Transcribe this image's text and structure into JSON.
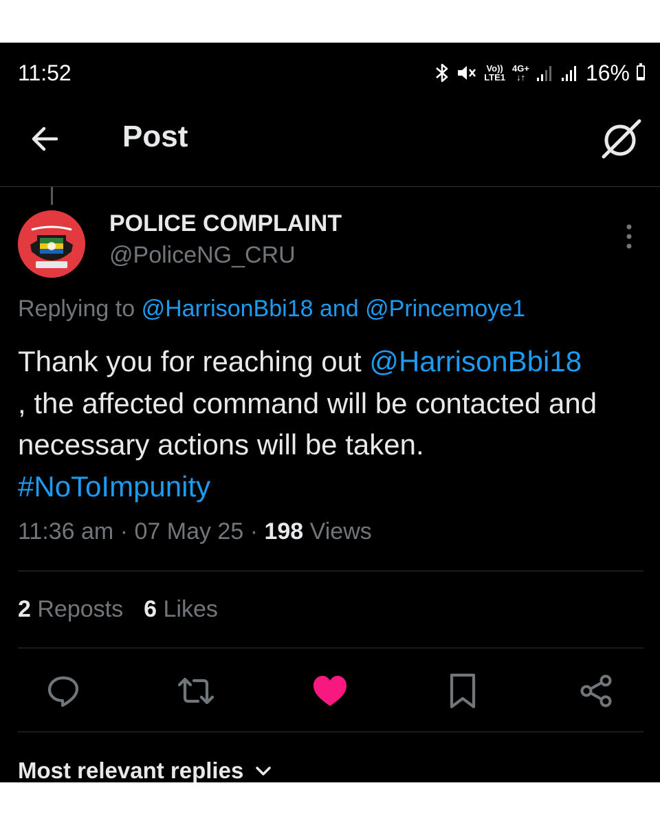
{
  "status_bar": {
    "time": "11:52",
    "volte_line1": "Vo))",
    "volte_line2": "LTE1",
    "net_line1": "4G+",
    "net_line2": "↓↑",
    "battery_label": "16%",
    "battery_level": 0.16,
    "icons": [
      "bluetooth-icon",
      "mute-icon",
      "volte-icon",
      "4g-icon",
      "signal-icon",
      "signal-icon",
      "battery-icon"
    ]
  },
  "header": {
    "title": "Post",
    "back_icon": "arrow-left-icon",
    "grok_icon": "grok-icon"
  },
  "post": {
    "author_name": "POLICE COMPLAINT",
    "author_handle": "@PoliceNG_CRU",
    "reply_prefix": "Replying to",
    "reply_user1": "@HarrisonBbi18",
    "reply_and": "and",
    "reply_user2": "@Princemoye1",
    "text_part1": "Thank you for reaching out",
    "text_mention": "@HarrisonBbi18",
    "text_part2": ", the affected command will be contacted and necessary actions will be taken.",
    "hashtag": "#NoToImpunity",
    "time": "11:36 am",
    "date": "07 May 25",
    "dot": "·",
    "views_count": "198",
    "views_label": "Views"
  },
  "stats": {
    "reposts_count": "2",
    "reposts_label": "Reposts",
    "likes_count": "6",
    "likes_label": "Likes"
  },
  "actions": {
    "icons": [
      "reply-icon",
      "repost-icon",
      "like-icon",
      "bookmark-icon",
      "share-icon"
    ],
    "like_color": "#f91880"
  },
  "colors": {
    "background": "#000000",
    "text": "#e7e9ea",
    "secondary": "#71767b",
    "link": "#1d9bf0",
    "like": "#f91880",
    "avatar": "#e23a3f"
  },
  "replies": {
    "label": "Most relevant replies",
    "icon": "chevron-down-icon"
  }
}
